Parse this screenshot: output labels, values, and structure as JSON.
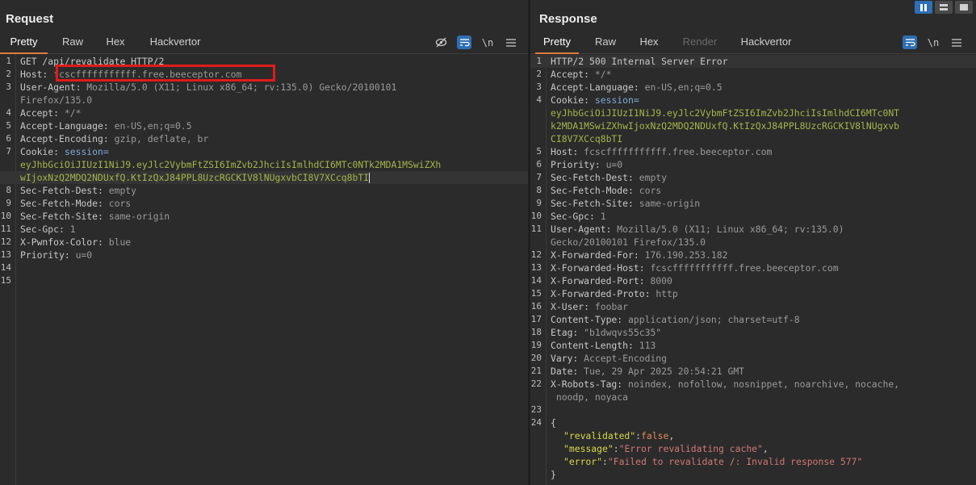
{
  "request": {
    "title": "Request",
    "tabs": [
      "Pretty",
      "Raw",
      "Hex",
      "Hackvertor"
    ],
    "lines": [
      {
        "n": "1",
        "k": "GET /api/revalidate HTTP/2",
        "v": ""
      },
      {
        "n": "2",
        "k": "Host: ",
        "v": "fcscfffffffffff.free.beeceptor.com"
      },
      {
        "n": "3",
        "k": "User-Agent: ",
        "v": "Mozilla/5.0 (X11; Linux x86_64; rv:135.0) Gecko/20100101"
      },
      {
        "n": "",
        "k": "",
        "v": "Firefox/135.0"
      },
      {
        "n": "4",
        "k": "Accept: ",
        "v": "*/*"
      },
      {
        "n": "5",
        "k": "Accept-Language: ",
        "v": "en-US,en;q=0.5"
      },
      {
        "n": "6",
        "k": "Accept-Encoding: ",
        "v": "gzip, deflate, br"
      },
      {
        "n": "7",
        "k": "Cookie: ",
        "v": "",
        "cv": "session="
      },
      {
        "n": "",
        "k": "",
        "v": "",
        "tok": "eyJhbGciOiJIUzI1NiJ9.eyJlc2VybmFtZSI6ImZvb2JhciIsImlhdCI6MTc0NTk2MDA1MSwiZXh"
      },
      {
        "n": "",
        "k": "",
        "v": "",
        "tok": "wIjoxNzQ2MDQ2NDUxfQ.KtIzQxJ84PPL8UzcRGCKIV8lNUgxvbCI8V7XCcq8bTI",
        "cursor": true,
        "hl": true
      },
      {
        "n": "8",
        "k": "Sec-Fetch-Dest: ",
        "v": "empty"
      },
      {
        "n": "9",
        "k": "Sec-Fetch-Mode: ",
        "v": "cors"
      },
      {
        "n": "10",
        "k": "Sec-Fetch-Site: ",
        "v": "same-origin"
      },
      {
        "n": "11",
        "k": "Sec-Gpc: ",
        "v": "1"
      },
      {
        "n": "12",
        "k": "X-Pwnfox-Color: ",
        "v": "blue"
      },
      {
        "n": "13",
        "k": "Priority: ",
        "v": "u=0"
      },
      {
        "n": "14",
        "k": "",
        "v": ""
      },
      {
        "n": "15",
        "k": "",
        "v": ""
      }
    ]
  },
  "response": {
    "title": "Response",
    "tabs": [
      "Pretty",
      "Raw",
      "Hex",
      "Render",
      "Hackvertor"
    ],
    "lines": [
      {
        "n": "1",
        "k": "HTTP/2 500 Internal Server Error",
        "v": "",
        "hl": true
      },
      {
        "n": "2",
        "k": "Accept: ",
        "v": "*/*"
      },
      {
        "n": "3",
        "k": "Accept-Language: ",
        "v": "en-US,en;q=0.5"
      },
      {
        "n": "4",
        "k": "Cookie: ",
        "v": "",
        "cv": "session="
      },
      {
        "n": "",
        "k": "",
        "v": "",
        "tok": "eyJhbGciOiJIUzI1NiJ9.eyJlc2VybmFtZSI6ImZvb2JhciIsImlhdCI6MTc0NT"
      },
      {
        "n": "",
        "k": "",
        "v": "",
        "tok": "k2MDA1MSwiZXhwIjoxNzQ2MDQ2NDUxfQ.KtIzQxJ84PPL8UzcRGCKIV8lNUgxvb"
      },
      {
        "n": "",
        "k": "",
        "v": "",
        "tok": "CI8V7XCcq8bTI"
      },
      {
        "n": "5",
        "k": "Host: ",
        "v": "fcscfffffffffff.free.beeceptor.com"
      },
      {
        "n": "6",
        "k": "Priority: ",
        "v": "u=0"
      },
      {
        "n": "7",
        "k": "Sec-Fetch-Dest: ",
        "v": "empty"
      },
      {
        "n": "8",
        "k": "Sec-Fetch-Mode: ",
        "v": "cors"
      },
      {
        "n": "9",
        "k": "Sec-Fetch-Site: ",
        "v": "same-origin"
      },
      {
        "n": "10",
        "k": "Sec-Gpc: ",
        "v": "1"
      },
      {
        "n": "11",
        "k": "User-Agent: ",
        "v": "Mozilla/5.0 (X11; Linux x86_64; rv:135.0)"
      },
      {
        "n": "",
        "k": "",
        "v": "Gecko/20100101 Firefox/135.0"
      },
      {
        "n": "12",
        "k": "X-Forwarded-For: ",
        "v": "176.190.253.182"
      },
      {
        "n": "13",
        "k": "X-Forwarded-Host: ",
        "v": "fcscfffffffffff.free.beeceptor.com"
      },
      {
        "n": "14",
        "k": "X-Forwarded-Port: ",
        "v": "8000"
      },
      {
        "n": "15",
        "k": "X-Forwarded-Proto: ",
        "v": "http"
      },
      {
        "n": "16",
        "k": "X-User: ",
        "v": "foobar"
      },
      {
        "n": "17",
        "k": "Content-Type: ",
        "v": "application/json; charset=utf-8"
      },
      {
        "n": "18",
        "k": "Etag: ",
        "v": "\"b1dwqvs55c35\""
      },
      {
        "n": "19",
        "k": "Content-Length: ",
        "v": "113"
      },
      {
        "n": "20",
        "k": "Vary: ",
        "v": "Accept-Encoding"
      },
      {
        "n": "21",
        "k": "Date: ",
        "v": "Tue, 29 Apr 2025 20:54:21 GMT"
      },
      {
        "n": "22",
        "k": "X-Robots-Tag: ",
        "v": "noindex, nofollow, nosnippet, noarchive, nocache,"
      },
      {
        "n": "",
        "k": "",
        "v": " noodp, noyaca"
      },
      {
        "n": "23",
        "k": "",
        "v": ""
      },
      {
        "n": "24",
        "k": "{",
        "v": ""
      },
      {
        "n": "",
        "json": true,
        "key": "\"revalidated\"",
        "sep": ":",
        "val": "false",
        "valtype": "bool",
        "tail": ","
      },
      {
        "n": "",
        "json": true,
        "key": "\"message\"",
        "sep": ":",
        "val": "\"Error revalidating cache\"",
        "valtype": "str",
        "tail": ","
      },
      {
        "n": "",
        "json": true,
        "key": "\"error\"",
        "sep": ":",
        "val": "\"Failed to revalidate /: Invalid response 577\"",
        "valtype": "str",
        "tail": ""
      },
      {
        "n": "",
        "k": "}",
        "v": ""
      }
    ]
  },
  "toolbar": {
    "line_break_label": "\\n"
  }
}
